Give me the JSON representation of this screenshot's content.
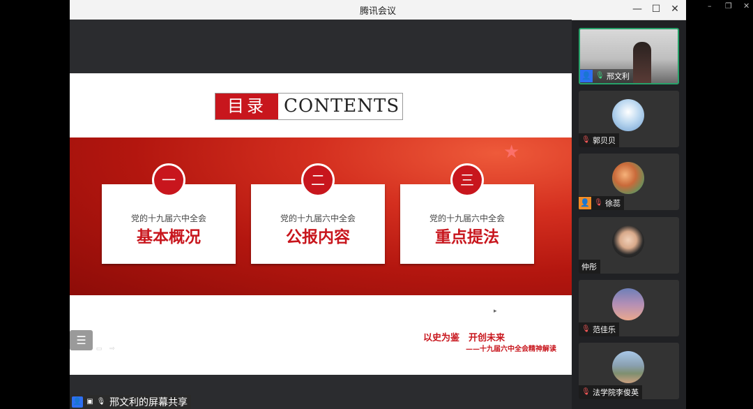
{
  "window": {
    "title": "腾讯会议",
    "minimize": "—",
    "maximize": "☐",
    "close": "✕"
  },
  "outer_window": {
    "minimize": "–",
    "restore": "❐",
    "close": "✕"
  },
  "slide": {
    "toc_cn": "目录",
    "toc_en": "CONTENTS",
    "cards": [
      {
        "num": "一",
        "subtitle": "党的十九届六中全会",
        "title": "基本概况"
      },
      {
        "num": "二",
        "subtitle": "党的十九届六中全会",
        "title": "公报内容"
      },
      {
        "num": "三",
        "subtitle": "党的十九届六中全会",
        "title": "重点提法"
      }
    ],
    "slogan_main": "以史为鉴　开创未来",
    "slogan_sub": "——十九届六中全会精神解读"
  },
  "share_bar": {
    "label": "邢文利的屏幕共享"
  },
  "participants": [
    {
      "name": "邢文利",
      "active": true,
      "host": true,
      "muted": false
    },
    {
      "name": "郭贝贝",
      "active": false,
      "host": false,
      "muted": true
    },
    {
      "name": "徐蕊",
      "active": false,
      "host": true,
      "muted": true
    },
    {
      "name": "仲彤",
      "active": false,
      "host": false,
      "muted": false
    },
    {
      "name": "范佳乐",
      "active": false,
      "host": false,
      "muted": true
    },
    {
      "name": "法学院李俊英",
      "active": false,
      "host": false,
      "muted": true
    }
  ],
  "colors": {
    "accent_red": "#c8161d",
    "active_green": "#27a26a",
    "host_blue": "#2e6ff2",
    "host_orange": "#f08c28"
  }
}
